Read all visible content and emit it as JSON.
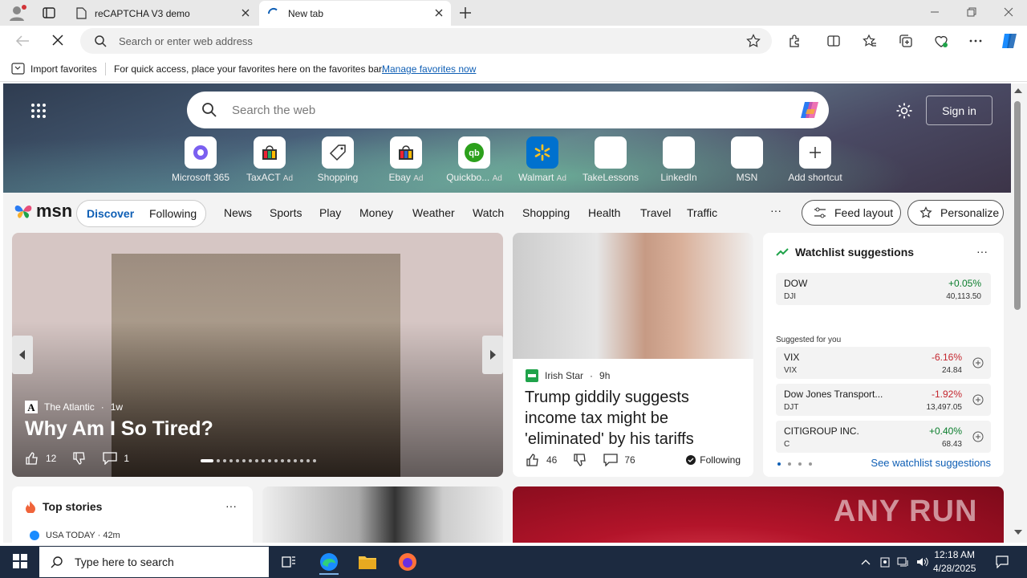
{
  "browser": {
    "tabs": [
      {
        "title": "reCAPTCHA V3 demo"
      },
      {
        "title": "New tab"
      }
    ],
    "address_placeholder": "Search or enter web address",
    "favorites_bar": {
      "import_label": "Import favorites",
      "hint": "For quick access, place your favorites here on the favorites bar.",
      "manage_link": "Manage favorites now"
    }
  },
  "newtab": {
    "search_placeholder": "Search the web",
    "sign_in": "Sign in",
    "tiles": [
      {
        "label": "Microsoft 365",
        "ad": ""
      },
      {
        "label": "TaxACT",
        "ad": "Ad"
      },
      {
        "label": "Shopping",
        "ad": ""
      },
      {
        "label": "Ebay",
        "ad": "Ad"
      },
      {
        "label": "Quickbo...",
        "ad": "Ad"
      },
      {
        "label": "Walmart",
        "ad": "Ad"
      },
      {
        "label": "TakeLessons",
        "ad": ""
      },
      {
        "label": "LinkedIn",
        "ad": ""
      },
      {
        "label": "MSN",
        "ad": ""
      },
      {
        "label": "Add shortcut",
        "ad": ""
      }
    ]
  },
  "msn": {
    "logo": "msn",
    "discover": "Discover",
    "following": "Following",
    "nav": [
      "News",
      "Sports",
      "Play",
      "Money",
      "Weather",
      "Watch",
      "Shopping",
      "Health",
      "Travel",
      "Traffic"
    ],
    "more": "···",
    "feed_layout": "Feed layout",
    "personalize": "Personalize"
  },
  "lead_story": {
    "source": "The Atlantic",
    "age": "1w",
    "title": "Why Am I So Tired?",
    "likes": "12",
    "comments": "1"
  },
  "story2": {
    "source": "Irish Star",
    "age": "9h",
    "title": "Trump giddily suggests income tax might be 'eliminated' by his tariffs",
    "likes": "46",
    "comments": "76",
    "following": "Following"
  },
  "watchlist": {
    "title": "Watchlist suggestions",
    "more": "···",
    "suggested_label": "Suggested for you",
    "see_more": "See watchlist suggestions",
    "stocks": [
      {
        "name": "DOW",
        "ticker": "DJI",
        "change": "+0.05%",
        "price": "40,113.50",
        "dir": "up"
      },
      {
        "name": "VIX",
        "ticker": "VIX",
        "change": "-6.16%",
        "price": "24.84",
        "dir": "down"
      },
      {
        "name": "Dow Jones Transport...",
        "ticker": "DJT",
        "change": "-1.92%",
        "price": "13,497.05",
        "dir": "down"
      },
      {
        "name": "CITIGROUP INC.",
        "ticker": "C",
        "change": "+0.40%",
        "price": "68.43",
        "dir": "up"
      }
    ],
    "colors": {
      "up": "#0a7d2c",
      "down": "#c4262e"
    }
  },
  "top_stories": {
    "title": "Top stories",
    "more": "···",
    "source": "USA TODAY · 42m"
  },
  "watermark": "ANY RUN",
  "taskbar": {
    "search_placeholder": "Type here to search",
    "time": "12:18 AM",
    "date": "4/28/2025"
  }
}
